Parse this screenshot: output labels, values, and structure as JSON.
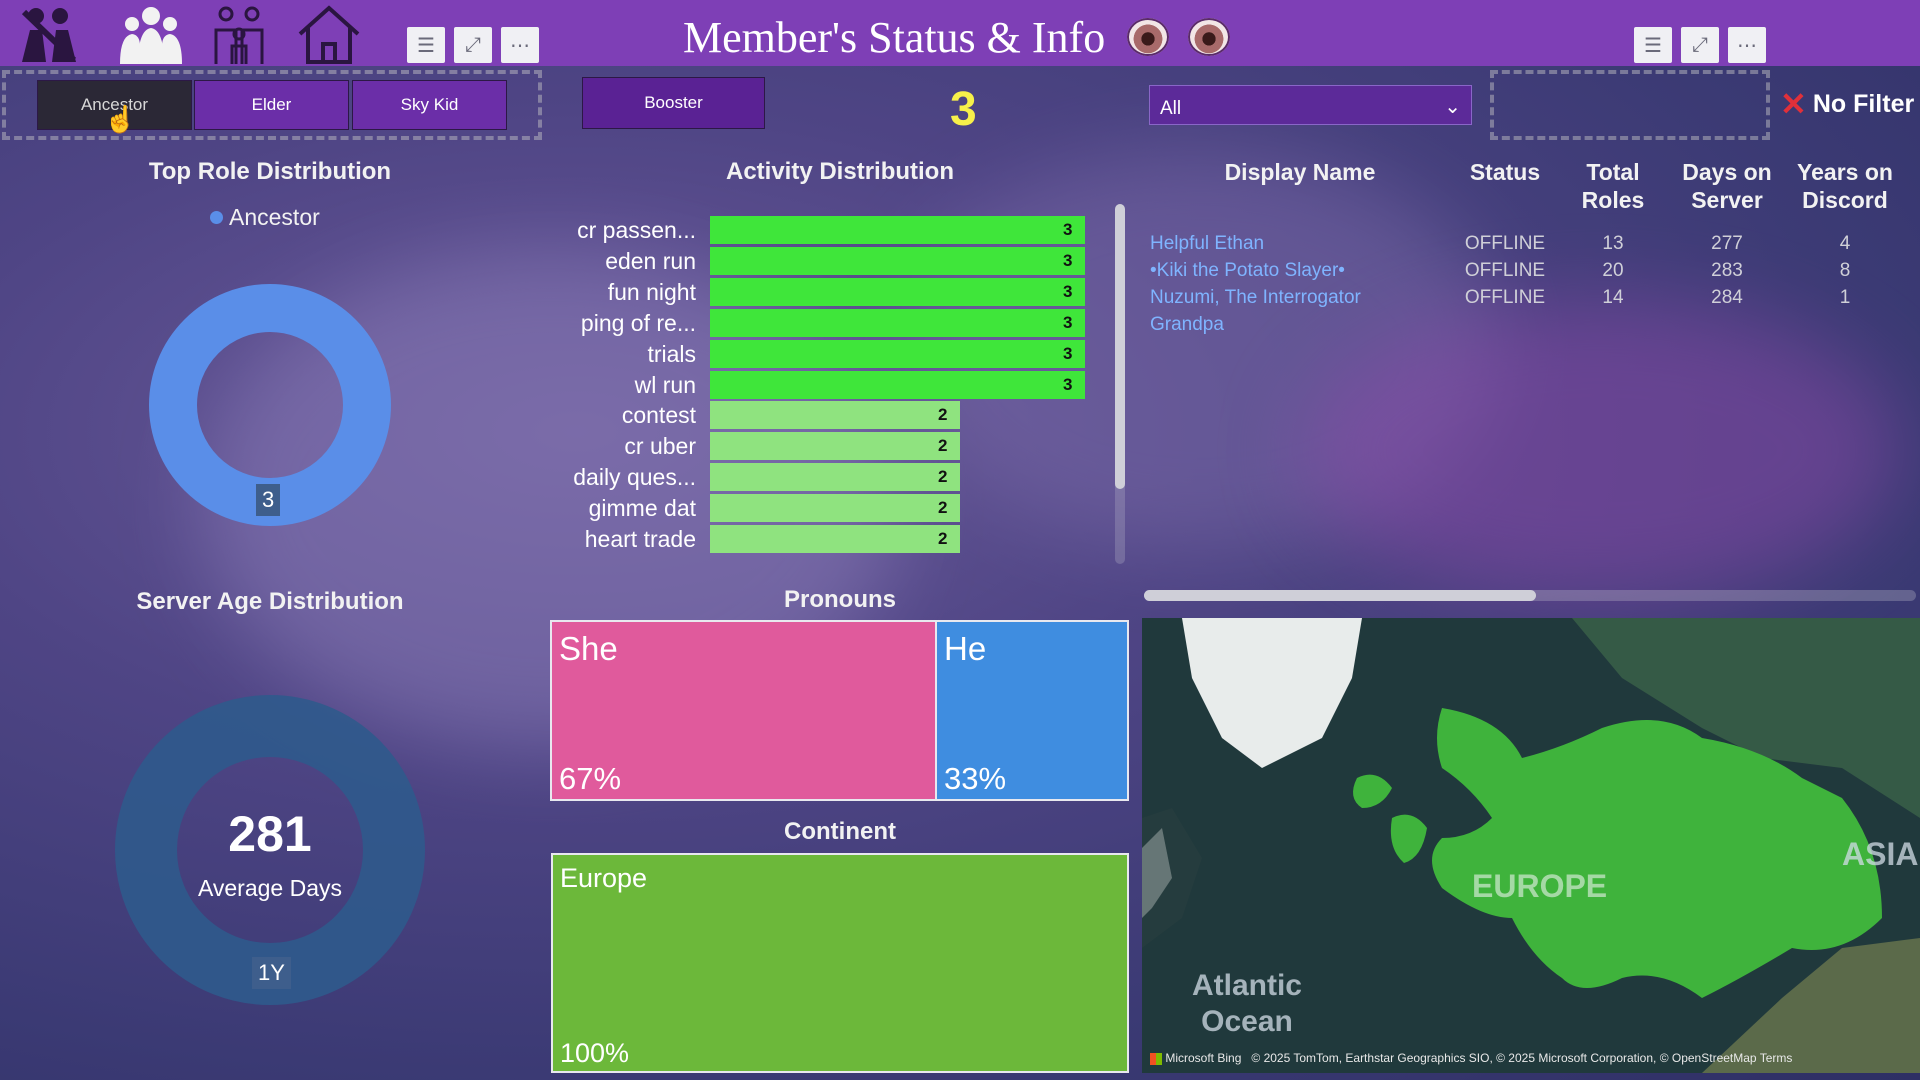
{
  "header": {
    "title": "Member's Status & Info",
    "nav_icons": [
      "people-crossed-icon",
      "group-icon",
      "family-icon",
      "home-icon"
    ],
    "left_actions": [
      "filter-icon",
      "expand-icon",
      "more-icon"
    ],
    "right_actions": [
      "filter-icon",
      "expand-icon",
      "more-icon"
    ]
  },
  "slicers": {
    "roles": [
      {
        "label": "Ancestor",
        "active": true
      },
      {
        "label": "Elder",
        "active": false
      },
      {
        "label": "Sky Kid",
        "active": false
      }
    ],
    "booster_label": "Booster",
    "member_count": "3",
    "dropdown_value": "All",
    "clear_filter_label": "No Filter"
  },
  "top_role": {
    "title": "Top Role Distribution",
    "legend": "Ancestor",
    "value_label": "3",
    "color": "#5a8ee8"
  },
  "server_age": {
    "title": "Server Age Distribution",
    "center_value": "281",
    "center_caption": "Average Days",
    "segment_label": "1Y",
    "color": "#2f5a8c"
  },
  "activity": {
    "title": "Activity Distribution",
    "chart_data": {
      "type": "bar",
      "orientation": "horizontal",
      "categories": [
        "cr passen...",
        "eden run",
        "fun night",
        "ping of re...",
        "trials",
        "wl run",
        "contest",
        "cr uber",
        "daily ques...",
        "gimme dat",
        "heart trade"
      ],
      "values": [
        3,
        3,
        3,
        3,
        3,
        3,
        2,
        2,
        2,
        2,
        2
      ],
      "title": "Activity Distribution",
      "xlim": [
        0,
        3
      ],
      "colors": {
        "high": "#3fe63a",
        "low": "#8fe37f"
      }
    }
  },
  "pronouns": {
    "title": "Pronouns",
    "chart_data": {
      "type": "treemap",
      "categories": [
        "She",
        "He"
      ],
      "values": [
        67,
        33
      ],
      "labels": [
        "67%",
        "33%"
      ],
      "colors": [
        "#e05a9c",
        "#3f8de0"
      ]
    }
  },
  "continent": {
    "title": "Continent",
    "chart_data": {
      "type": "treemap",
      "categories": [
        "Europe"
      ],
      "values": [
        100
      ],
      "labels": [
        "100%"
      ],
      "colors": [
        "#6cb83a"
      ]
    }
  },
  "table": {
    "columns": [
      "Display Name",
      "Status",
      "Total Roles",
      "Days on Server",
      "Years on Discord"
    ],
    "rows": [
      {
        "name": "Helpful Ethan",
        "status": "OFFLINE",
        "roles": "13",
        "days": "277",
        "years": "4"
      },
      {
        "name": "•Kiki the Potato Slayer•",
        "status": "OFFLINE",
        "roles": "20",
        "days": "283",
        "years": "8"
      },
      {
        "name": "Nuzumi, The Interrogator",
        "status": "OFFLINE",
        "roles": "14",
        "days": "284",
        "years": "1"
      },
      {
        "name": "Grandpa",
        "status": "",
        "roles": "",
        "days": "",
        "years": ""
      }
    ]
  },
  "map": {
    "labels": [
      "EUROPE",
      "ASIA",
      "Atlantic Ocean"
    ],
    "provider": "Microsoft Bing",
    "copyright": "© 2025 TomTom, Earthstar Geographics SIO, © 2025 Microsoft Corporation, © OpenStreetMap  Terms"
  }
}
